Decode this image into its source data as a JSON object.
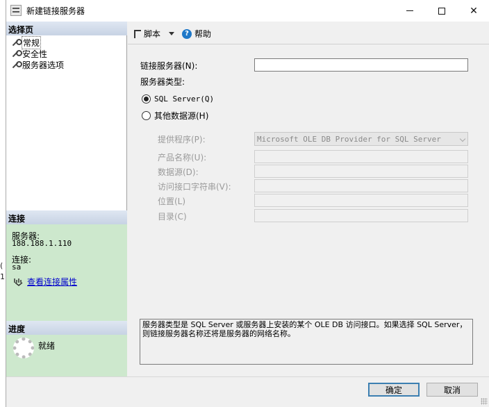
{
  "background_fragments": [
    "(",
    "1"
  ],
  "window": {
    "title": "新建链接服务器",
    "minimize_icon": "minimize-icon",
    "maximize_icon": "maximize-icon",
    "close_glyph": "✕"
  },
  "left_panel": {
    "select_page_header": "选择页",
    "pages": [
      {
        "label": "常规",
        "icon": "wrench-icon",
        "selected": true
      },
      {
        "label": "安全性",
        "icon": "wrench-icon"
      },
      {
        "label": "服务器选项",
        "icon": "wrench-icon"
      }
    ],
    "connection_header": "连接",
    "server_label": "服务器:",
    "server_value": "188.188.1.110",
    "connection_label": "连接:",
    "connection_value": "sa",
    "view_conn_props_link": "查看连接属性",
    "progress_header": "进度",
    "progress_status": "就绪"
  },
  "toolbar": {
    "script_label": "脚本",
    "help_label": "帮助"
  },
  "form": {
    "linked_server_label": "链接服务器(N):",
    "linked_server_value": "",
    "server_type_label": "服务器类型:",
    "radio_sql_server": "SQL Server(Q)",
    "radio_other_source": "其他数据源(H)",
    "provider_label": "提供程序(P):",
    "provider_value": "Microsoft OLE DB Provider for SQL Server",
    "product_name_label": "产品名称(U):",
    "data_source_label": "数据源(D):",
    "provider_string_label": "访问接口字符串(V):",
    "location_label": "位置(L)",
    "catalog_label": "目录(C)",
    "description": "服务器类型是 SQL Server 或服务器上安装的某个 OLE DB 访问接口。如果选择 SQL Server，则链接服务器名称还将是服务器的网络名称。"
  },
  "buttons": {
    "ok": "确定",
    "cancel": "取消"
  }
}
